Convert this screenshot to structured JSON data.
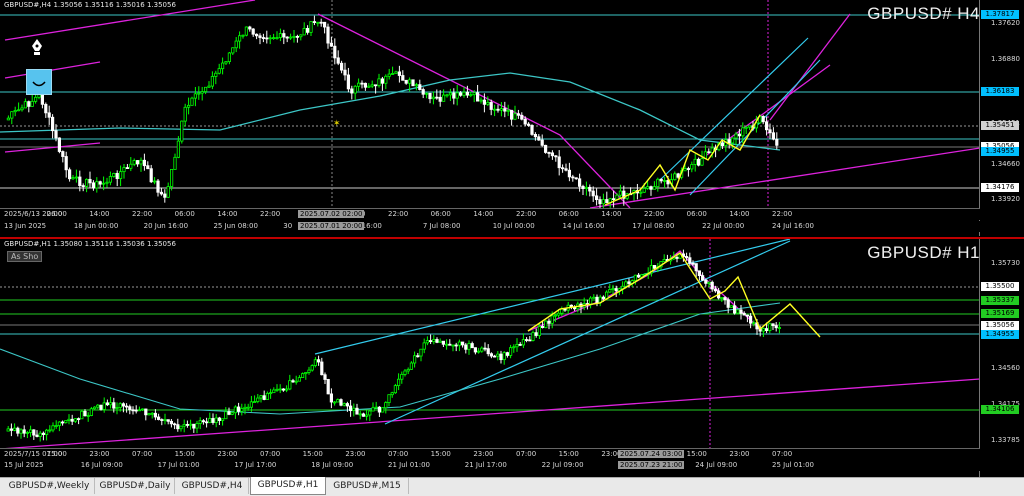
{
  "h4": {
    "header": "GBPUSD#,H4  1.35056 1.35116 1.35016 1.35056",
    "symbol": "GBPUSD# H4",
    "axis_ticks": [
      "1.37620",
      "1.36880",
      "1.35451",
      "1.34660",
      "1.33920"
    ],
    "price_tags": [
      {
        "text": "1.37817",
        "color": "#00bfff"
      },
      {
        "text": "1.36183",
        "color": "#00bfff"
      },
      {
        "text": "1.35451",
        "color": "#d0d0d0"
      },
      {
        "text": "1.35056",
        "color": "#ffffff"
      },
      {
        "text": "1.34955",
        "color": "#00bfff"
      },
      {
        "text": "1.34176",
        "color": "#ffffff"
      }
    ],
    "time_row1": [
      "2025/6/13 22:00",
      "06:00",
      "14:00",
      "22:00",
      "06:00",
      "14:00",
      "22:00",
      "06:00",
      "14:00",
      "22:00",
      "06:00",
      "14:00",
      "22:00",
      "06:00",
      "14:00",
      "22:00",
      "06:00",
      "14:00",
      "22:00"
    ],
    "time_row1_highlight": "2025.07.02 02:00",
    "time_row2": [
      "13 Jun 2025",
      "18 Jun 00:00",
      "20 Jun 16:00",
      "25 Jun 08:00",
      "30",
      "ul 16:00",
      "7 Jul 08:00",
      "10 Jul 00:00",
      "14 Jul 16:00",
      "17 Jul 08:00",
      "22 Jul 00:00",
      "24 Jul 16:00"
    ],
    "time_row2_highlight": "2025.07.01 20:00"
  },
  "h1": {
    "header": "GBPUSD#,H1  1.35080 1.35116 1.35036 1.35056",
    "as_show": "As Sho",
    "symbol": "GBPUSD# H1",
    "axis_ticks": [
      "1.35730",
      "1.34560",
      "1.34175",
      "1.33785"
    ],
    "price_tags": [
      {
        "text": "1.35500",
        "color": "#ffffff"
      },
      {
        "text": "1.35337",
        "color": "#22cc22"
      },
      {
        "text": "1.35169",
        "color": "#22cc22"
      },
      {
        "text": "1.35056",
        "color": "#ffffff"
      },
      {
        "text": "1.34955",
        "color": "#00bfff"
      },
      {
        "text": "1.34106",
        "color": "#22cc22"
      }
    ],
    "time_row1": [
      "2025/7/15 07:00",
      "15:00",
      "23:00",
      "07:00",
      "15:00",
      "23:00",
      "07:00",
      "15:00",
      "23:00",
      "07:00",
      "15:00",
      "23:00",
      "07:00",
      "15:00",
      "23:00",
      "07:00",
      "15:00",
      "23:00",
      "07:00"
    ],
    "time_row1_highlight": "2025.07.24 03:00",
    "time_row2": [
      "15 Jul 2025",
      "16 Jul 09:00",
      "17 Jul 01:00",
      "17 Jul 17:00",
      "18 Jul 09:00",
      "21 Jul 01:00",
      "21 Jul 17:00",
      "22 Jul 09:00",
      "23 Jul 01:00",
      "24 Jul 09:00",
      "25 Jul 01:00"
    ],
    "time_row2_highlight": "2025.07.23 21:00"
  },
  "tabs": [
    {
      "label": "GBPUSD#,Weekly",
      "active": false
    },
    {
      "label": "GBPUSD#,Daily",
      "active": false
    },
    {
      "label": "GBPUSD#,H4",
      "active": false
    },
    {
      "label": "GBPUSD#,H1",
      "active": true
    },
    {
      "label": "GBPUSD#,M15",
      "active": false
    }
  ],
  "colors": {
    "background": "#000000",
    "bull": "#00ff00",
    "bear": "#ffffff",
    "ma": "#3cc6c6",
    "channel": "#33ccee",
    "trend": "#dd22dd",
    "zigzag": "#ffff22",
    "active_tab_border": "#c00000"
  },
  "icons": {
    "pen": "pen-icon",
    "smile": "smile-icon"
  }
}
